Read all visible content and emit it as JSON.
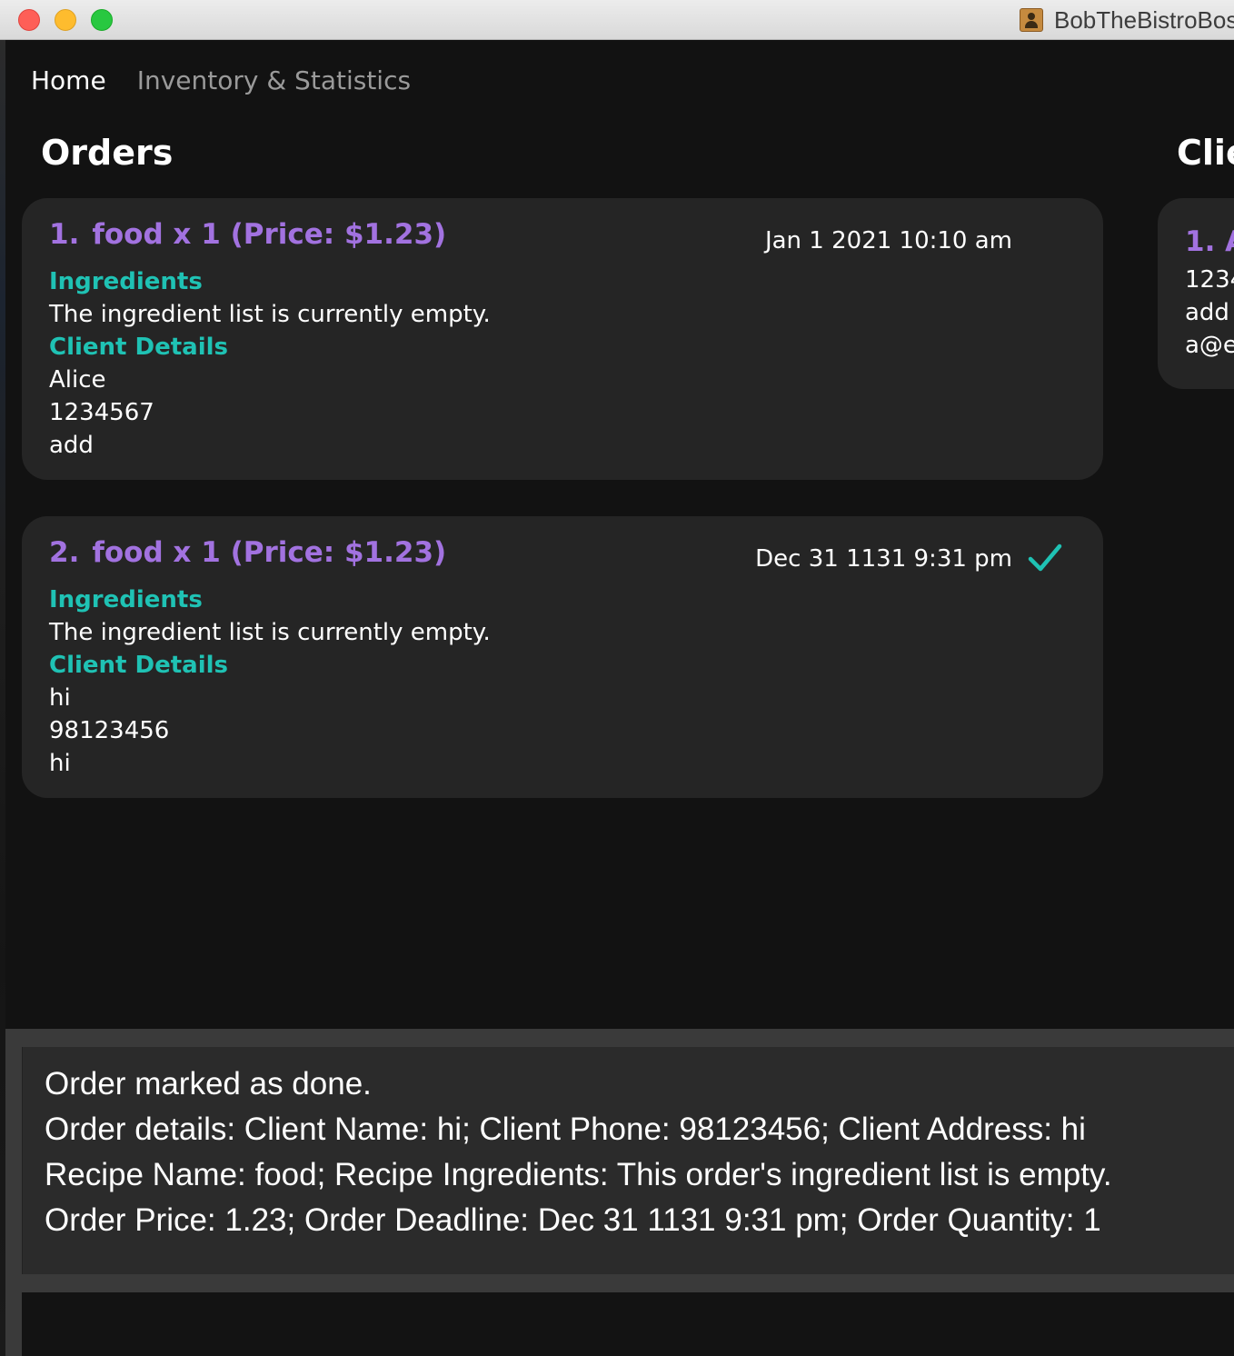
{
  "window": {
    "title": "BobTheBistroBos",
    "controls": [
      "close",
      "minimize",
      "maximize"
    ]
  },
  "menu": {
    "home": "Home",
    "inventory": "Inventory & Statistics"
  },
  "orders": {
    "title": "Orders",
    "items": [
      {
        "index": "1.",
        "summary": "food x 1 (Price: $1.23)",
        "deadline": "Jan 1 2021 10:10 am",
        "done": false,
        "ingredients_label": "Ingredients",
        "ingredients_text": "The ingredient list is currently empty.",
        "client_label": "Client Details",
        "client_name": "Alice",
        "client_phone": "1234567",
        "client_address": "add"
      },
      {
        "index": "2.",
        "summary": "food x 1 (Price: $1.23)",
        "deadline": "Dec 31 1131 9:31 pm",
        "done": true,
        "ingredients_label": "Ingredients",
        "ingredients_text": "The ingredient list is currently empty.",
        "client_label": "Client Details",
        "client_name": "hi",
        "client_phone": "98123456",
        "client_address": "hi"
      }
    ]
  },
  "clients": {
    "title": "Clie",
    "items": [
      {
        "index": "1.",
        "name_fragment": "A",
        "phone_fragment": "1234",
        "address_fragment": "add",
        "email_fragment": "a@e"
      }
    ]
  },
  "result": {
    "lines": [
      "Order marked as done.",
      "Order details: Client Name: hi; Client Phone: 98123456; Client Address: hi",
      "Recipe Name: food; Recipe Ingredients: This order's ingredient list is empty.",
      "Order Price: 1.23; Order Deadline: Dec 31 1131 9:31 pm; Order Quantity: 1"
    ]
  },
  "command": {
    "value": ""
  },
  "colors": {
    "accent_purple": "#a272e0",
    "accent_teal": "#1fc2b4",
    "background": "#121212",
    "card": "#252525"
  }
}
